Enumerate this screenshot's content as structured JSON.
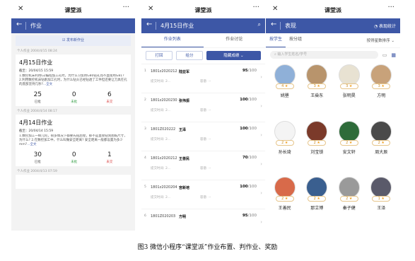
{
  "caption": "图3  微信小程序“课堂派”作业布置、判作业、奖励",
  "phone1": {
    "close": "✕",
    "title": "课堂派",
    "more": "···",
    "nav": {
      "back": "←",
      "title": "作业"
    },
    "publish": "发布新作业",
    "cards": [
      {
        "who": "个人作业 2004/4/15 08:24",
        "title": "4月15日作业",
        "deadline": "截至：20/04/15 15:59",
        "desc": "1.数控机床利用G2编程加工孔时，为什么习惯用G80钻孔而不直接用G81? 2.利用数控机床钻削加工孔时，为什么钻头已经钻透了工件但还要让刀具在孔的底部坚持几秒?",
        "more": "...全文",
        "stats": [
          {
            "n": "25",
            "l": "已批"
          },
          {
            "n": "0",
            "l": "未批"
          },
          {
            "n": "6",
            "l": "未交"
          }
        ]
      },
      {
        "who": "个人作业 2004/4/14 08:17",
        "title": "4月14日作业",
        "deadline": "截至：20/04/14 15:59",
        "desc": "1.数控加工一样几何，很多情况下都要先钻后镗，那不是直接钻到图纸尺寸，为什么? 2.在数控加工中，什么叫做安全距离? 安全距离一般都设置为多少mm?",
        "more": "...全文",
        "stats": [
          {
            "n": "30",
            "l": "已批"
          },
          {
            "n": "0",
            "l": "未批"
          },
          {
            "n": "1",
            "l": "未交"
          }
        ]
      },
      {
        "who": "个人作业 2004/4/13 07:59",
        "title": "",
        "deadline": "",
        "desc": "",
        "more": "",
        "stats": []
      }
    ]
  },
  "phone2": {
    "close": "✕",
    "title": "课堂派",
    "more": "···",
    "nav": {
      "back": "←",
      "title": "4月15日作业",
      "icon": "⌕"
    },
    "tabs": [
      "作业列表",
      "作业讨论"
    ],
    "buttons": [
      "打回",
      "给分",
      "隐藏成绩 ⌄"
    ],
    "rows": [
      {
        "idx": "1",
        "id": "1801z2020212",
        "name": "陆亚军",
        "score": "95",
        "total": "/100",
        "time": "提交时间: 2...",
        "comment": "容意: --"
      },
      {
        "idx": "2",
        "id": "1801z2020230",
        "name": "张伟振",
        "score": "100",
        "total": "/100",
        "time": "提交时间: 2...",
        "comment": "容意: --"
      },
      {
        "idx": "3",
        "id": "1801Z020222",
        "name": "王泽",
        "score": "100",
        "total": "/100",
        "time": "提交时间: 2...",
        "comment": "容意: --"
      },
      {
        "idx": "4",
        "id": "1801z2020212",
        "name": "王善民",
        "score": "70",
        "total": "/100",
        "time": "提交时间: 2...",
        "comment": "容意: --"
      },
      {
        "idx": "5",
        "id": "1801z2020204",
        "name": "宫新培",
        "score": "100",
        "total": "/100",
        "time": "提交时间: 2...",
        "comment": "容意: --"
      },
      {
        "idx": "6",
        "id": "1801Z020203",
        "name": "方明",
        "score": "95",
        "total": "/100",
        "time": "",
        "comment": ""
      }
    ]
  },
  "phone3": {
    "close": "✕",
    "title": "课堂派",
    "more": "···",
    "nav": {
      "back": "←",
      "title": "表现",
      "stats": "◔ 表现统计"
    },
    "tabs": [
      "按学生",
      "按分组"
    ],
    "sort": "按得星数排序 ⌄",
    "search_placeholder": "输入学生姓名/学号",
    "students": [
      {
        "name": "姚瞾",
        "stars": "4",
        "color": "#8fb0d8"
      },
      {
        "name": "王燊东",
        "stars": "3",
        "color": "#b8946c"
      },
      {
        "name": "张明昊",
        "stars": "3",
        "color": "#e8e2d2"
      },
      {
        "name": "方明",
        "stars": "3",
        "color": "#c8a27a"
      },
      {
        "name": "孙长琦",
        "stars": "2",
        "color": "#f4f4f4"
      },
      {
        "name": "刘宝锁",
        "stars": "2",
        "color": "#7b3a2a"
      },
      {
        "name": "安文轩",
        "stars": "2",
        "color": "#2e6b3a"
      },
      {
        "name": "周大辰",
        "stars": "2",
        "color": "#4a4a4a"
      },
      {
        "name": "王善民",
        "stars": "2",
        "color": "#d86a4a"
      },
      {
        "name": "那立博",
        "stars": "2",
        "color": "#3a5f8f"
      },
      {
        "name": "秦子健",
        "stars": "2",
        "color": "#9a9a9a"
      },
      {
        "name": "王泽",
        "stars": "1",
        "color": "#5a5a6a"
      }
    ]
  }
}
